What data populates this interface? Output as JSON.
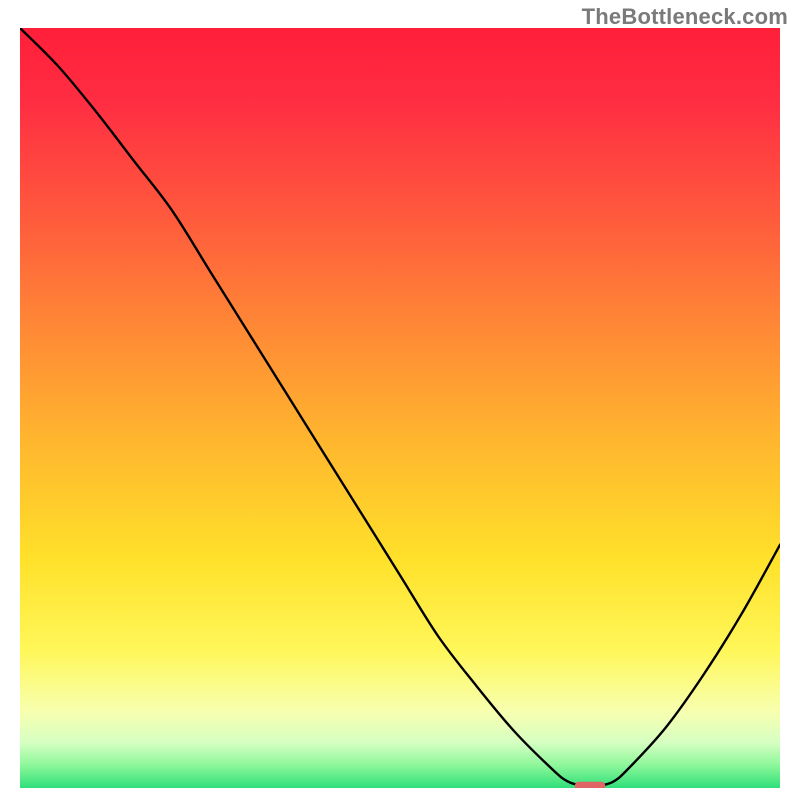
{
  "watermark": "TheBottleneck.com",
  "chart_data": {
    "type": "line",
    "title": "",
    "xlabel": "",
    "ylabel": "",
    "xlim": [
      0,
      100
    ],
    "ylim": [
      0,
      100
    ],
    "grid": false,
    "curve_note": "Decreasing curve to a minimum near x≈75 then rising; y values are relative (100 = top of plot, 0 = bottom).",
    "x": [
      0,
      5,
      10,
      15,
      20,
      25,
      30,
      35,
      40,
      45,
      50,
      55,
      60,
      65,
      70,
      72,
      74,
      76,
      78,
      80,
      85,
      90,
      95,
      100
    ],
    "y": [
      100,
      95,
      89,
      82.5,
      76,
      68,
      60,
      52,
      44,
      36,
      28,
      20,
      13.5,
      7.5,
      2.5,
      0.9,
      0.3,
      0.3,
      0.8,
      2.5,
      8,
      15,
      23,
      32
    ],
    "marker": {
      "note": "small rounded red bar at curve minimum",
      "x_center": 75,
      "width": 4,
      "y": 0.3,
      "color": "#e06666"
    },
    "background_gradient": {
      "type": "vertical",
      "stops": [
        {
          "pos": 0.0,
          "color": "#ff1f3a"
        },
        {
          "pos": 0.1,
          "color": "#ff2e42"
        },
        {
          "pos": 0.25,
          "color": "#ff5a3d"
        },
        {
          "pos": 0.4,
          "color": "#ff8a35"
        },
        {
          "pos": 0.55,
          "color": "#ffb82e"
        },
        {
          "pos": 0.7,
          "color": "#ffe12a"
        },
        {
          "pos": 0.82,
          "color": "#fff75a"
        },
        {
          "pos": 0.9,
          "color": "#f7ffb0"
        },
        {
          "pos": 0.94,
          "color": "#d6ffc2"
        },
        {
          "pos": 0.97,
          "color": "#8df79a"
        },
        {
          "pos": 1.0,
          "color": "#2fe07a"
        }
      ]
    }
  }
}
